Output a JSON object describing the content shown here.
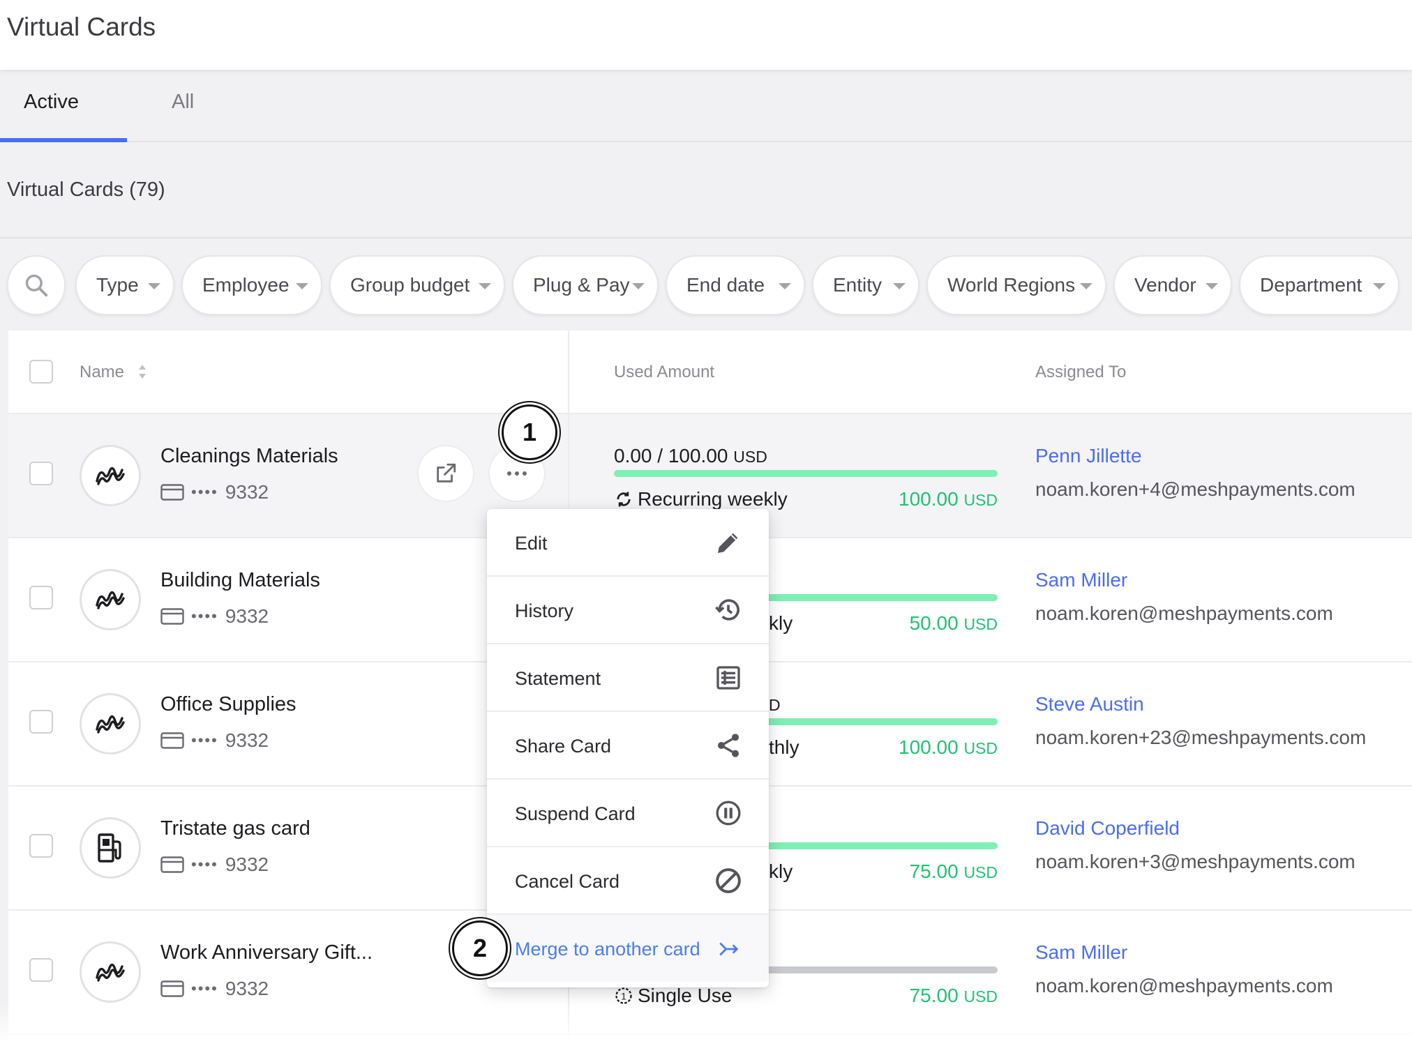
{
  "header": {
    "title": "Virtual Cards"
  },
  "tabs": [
    {
      "label": "Active",
      "active": true
    },
    {
      "label": "All",
      "active": false
    }
  ],
  "section": {
    "title": "Virtual Cards (79)"
  },
  "filters": [
    "Type",
    "Employee",
    "Group budget",
    "Plug & Pay",
    "End date",
    "Entity",
    "World Regions",
    "Vendor",
    "Department"
  ],
  "table": {
    "columns": {
      "name": "Name",
      "used_amount": "Used Amount",
      "assigned_to": "Assigned To"
    },
    "rows": [
      {
        "name": "Cleanings Materials",
        "card_number": "9332",
        "dots": "••••",
        "amount": "0.00 / 100.00",
        "amount_currency": "USD",
        "frequency": "Recurring weekly",
        "limit": "100.00",
        "limit_currency": "USD",
        "person": "Penn Jillette",
        "email": "noam.koren+4@meshpayments.com",
        "icon": "mesh-logo-icon"
      },
      {
        "name": "Building Materials",
        "card_number": "9332",
        "dots": "••••",
        "frequency_partial": "kly",
        "limit": "50.00",
        "limit_currency": "USD",
        "person": "Sam Miller",
        "email": "noam.koren@meshpayments.com",
        "icon": "mesh-logo-icon"
      },
      {
        "name": "Office Supplies",
        "card_number": "9332",
        "dots": "••••",
        "amount_partial": "D",
        "frequency_partial": "thly",
        "limit": "100.00",
        "limit_currency": "USD",
        "person": "Steve Austin",
        "email": "noam.koren+23@meshpayments.com",
        "icon": "mesh-logo-icon"
      },
      {
        "name": "Tristate gas card",
        "card_number": "9332",
        "dots": "••••",
        "frequency_partial": "kly",
        "limit": "75.00",
        "limit_currency": "USD",
        "person": "David Coperfield",
        "email": "noam.koren+3@meshpayments.com",
        "icon": "gas-station-icon"
      },
      {
        "name": "Work Anniversary Gift...",
        "card_number": "9332",
        "dots": "••••",
        "frequency": "Single Use",
        "limit": "75.00",
        "limit_currency": "USD",
        "person": "Sam Miller",
        "email": "noam.koren@meshpayments.com",
        "icon": "mesh-logo-icon"
      }
    ]
  },
  "menu": {
    "items": [
      {
        "label": "Edit",
        "icon": "pencil-icon"
      },
      {
        "label": "History",
        "icon": "history-icon"
      },
      {
        "label": "Statement",
        "icon": "statement-icon"
      },
      {
        "label": "Share Card",
        "icon": "share-icon"
      },
      {
        "label": "Suspend Card",
        "icon": "pause-icon"
      },
      {
        "label": "Cancel Card",
        "icon": "cancel-icon"
      },
      {
        "label": "Merge to another card",
        "icon": "merge-arrow-icon"
      }
    ]
  },
  "callouts": [
    "1",
    "2"
  ],
  "colors": {
    "accent": "#4a6cf7",
    "success": "#1fc371",
    "bar": "#7ef0b4"
  }
}
